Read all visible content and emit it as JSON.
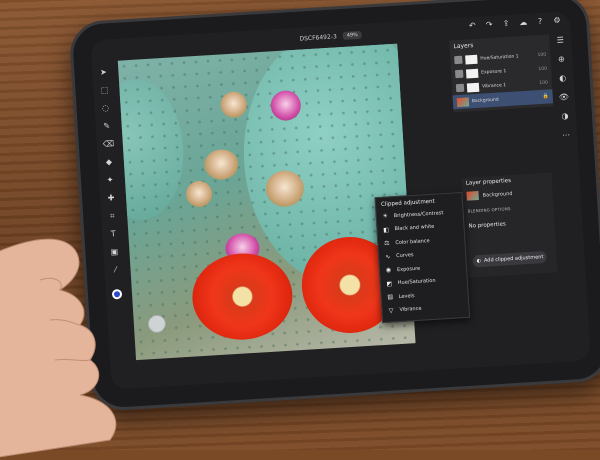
{
  "document": {
    "title": "DSCF6492-3",
    "zoom": "49%"
  },
  "toolbar_top_icons": [
    "undo-icon",
    "redo-icon",
    "share-icon",
    "cloud-icon",
    "help-icon",
    "settings-icon"
  ],
  "left_tools": [
    "move-icon",
    "select-icon",
    "lasso-icon",
    "brush-icon",
    "eraser-icon",
    "fill-icon",
    "clone-icon",
    "healing-icon",
    "crop-icon",
    "type-icon",
    "image-icon",
    "eyedropper-icon"
  ],
  "foreground_color": "#2a4bd0",
  "layers": {
    "title": "Layers",
    "items": [
      {
        "name": "Hue/Saturation 1",
        "thumb": "white",
        "opacity": "100"
      },
      {
        "name": "Exposure 1",
        "thumb": "white",
        "opacity": "100"
      },
      {
        "name": "Vibrance 1",
        "thumb": "white",
        "opacity": "100"
      },
      {
        "name": "Background",
        "thumb": "photo",
        "opacity": ""
      }
    ]
  },
  "layer_properties": {
    "title": "Layer properties",
    "layer_name": "Background",
    "blending_label": "BLENDING OPTIONS",
    "no_properties": "No properties",
    "add_clipped_label": "Add clipped adjustment"
  },
  "clipped_menu": {
    "title": "Clipped adjustment",
    "items": [
      {
        "label": "Brightness/Contrast",
        "icon": "sun-icon"
      },
      {
        "label": "Black and white",
        "icon": "bw-icon"
      },
      {
        "label": "Color balance",
        "icon": "color-balance-icon"
      },
      {
        "label": "Curves",
        "icon": "curves-icon"
      },
      {
        "label": "Exposure",
        "icon": "exposure-icon"
      },
      {
        "label": "Hue/Saturation",
        "icon": "hue-icon"
      },
      {
        "label": "Levels",
        "icon": "levels-icon"
      },
      {
        "label": "Vibrance",
        "icon": "vibrance-icon"
      }
    ]
  }
}
